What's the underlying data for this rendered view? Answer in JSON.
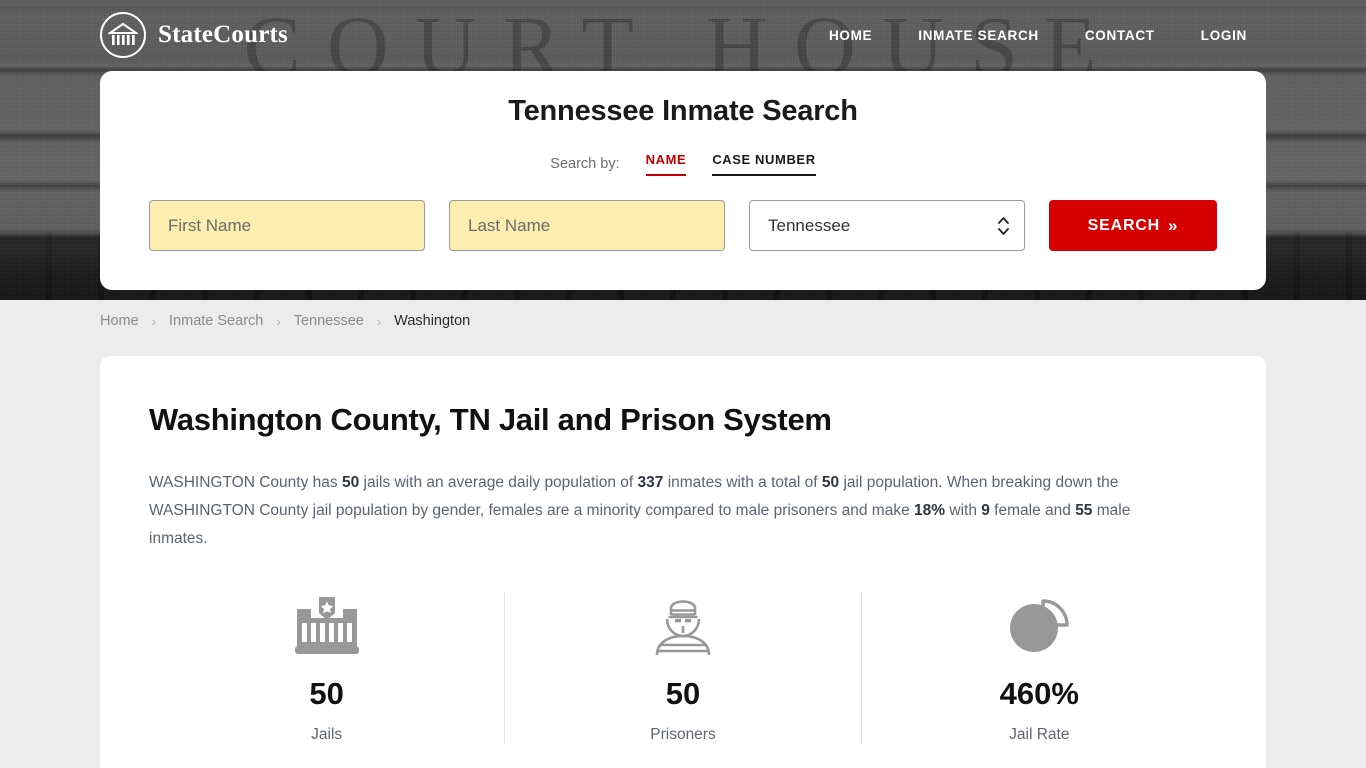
{
  "brand": {
    "name": "StateCourts",
    "logo_icon": "courthouse-logo-icon"
  },
  "nav": {
    "links": [
      {
        "label": "HOME"
      },
      {
        "label": "INMATE SEARCH"
      },
      {
        "label": "CONTACT"
      },
      {
        "label": "LOGIN"
      }
    ]
  },
  "hero": {
    "ghost_text": "COURT  HOUSE"
  },
  "search": {
    "title": "Tennessee Inmate Search",
    "search_by_label": "Search by:",
    "tabs": [
      {
        "label": "NAME",
        "active": true,
        "color": "#c00000"
      },
      {
        "label": "CASE NUMBER",
        "active": false,
        "color": "#1a1a1a"
      }
    ],
    "first_name_placeholder": "First Name",
    "first_name_value": "",
    "last_name_placeholder": "Last Name",
    "last_name_value": "",
    "state_selected": "Tennessee",
    "submit_label": "SEARCH",
    "submit_chevron": "»",
    "submit_color": "#d60000",
    "field_fill_color": "#fbeeae"
  },
  "breadcrumb": {
    "items": [
      {
        "label": "Home",
        "active": false
      },
      {
        "label": "Inmate Search",
        "active": false
      },
      {
        "label": "Tennessee",
        "active": false
      },
      {
        "label": "Washington",
        "active": true
      }
    ],
    "separator": "›"
  },
  "main": {
    "title": "Washington County, TN Jail and Prison System",
    "summary": {
      "p1": "WASHINGTON County has ",
      "b1": "50",
      "p2": " jails with an average daily population of ",
      "b2": "337",
      "p3": " inmates with a total of ",
      "b3": "50",
      "p4": " jail population. When breaking down the WASHINGTON County jail population by gender, females are a minority compared to male prisoners and make ",
      "b4": "18%",
      "p5": " with ",
      "b5": "9",
      "p6": " female and ",
      "b6": "55",
      "p7": " male inmates."
    },
    "stats": [
      {
        "icon": "jail-building-icon",
        "value": "50",
        "label": "Jails"
      },
      {
        "icon": "prisoner-icon",
        "value": "50",
        "label": "Prisoners"
      },
      {
        "icon": "pie-chart-icon",
        "value": "460%",
        "label": "Jail Rate"
      }
    ]
  }
}
